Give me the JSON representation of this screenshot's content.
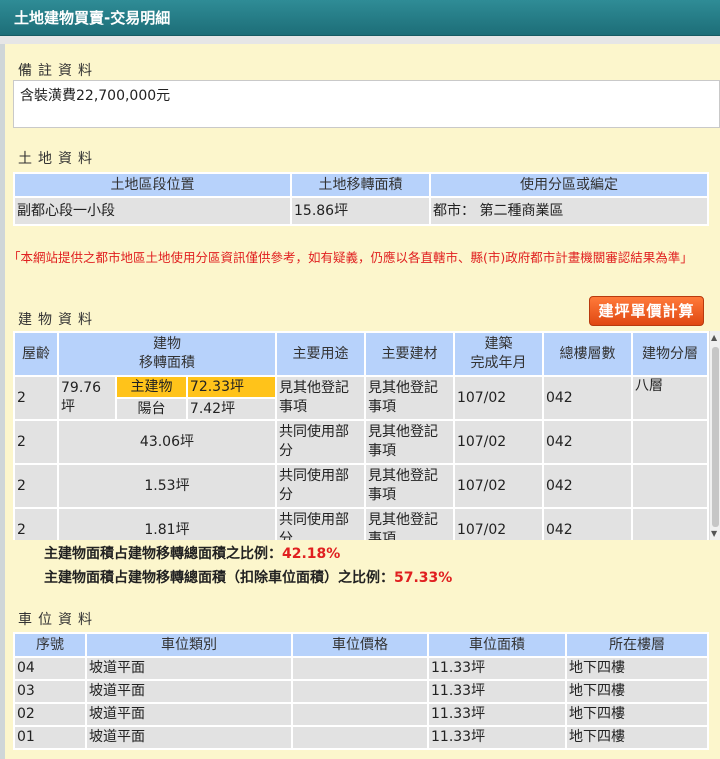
{
  "title": "土地建物買賣-交易明細",
  "note": {
    "heading": "備註資料",
    "text": "含裝潢費22,700,000元"
  },
  "land": {
    "heading": "土地資料",
    "headers": [
      "土地區段位置",
      "土地移轉面積",
      "使用分區或編定"
    ],
    "rows": [
      [
        "副都心段一小段",
        "15.86坪",
        "都市： 第二種商業區"
      ]
    ]
  },
  "warning": "「本網站提供之都市地區土地使用分區資訊僅供參考，如有疑義，仍應以各直轄市、縣(市)政府都市計畫機關審認結果為準」",
  "calc_button": "建坪單價計算",
  "building": {
    "heading": "建物資料",
    "headers": {
      "age": "屋齡",
      "area": "建物\n移轉面積",
      "use": "主要用途",
      "material": "主要建材",
      "built": "建築\n完成年月",
      "floors": "總樓層數",
      "division": "建物分層"
    },
    "first_row": {
      "age": "2",
      "total_area": "79.76坪",
      "main_label": "主建物",
      "main_area": "72.33坪",
      "balcony_label": "陽台",
      "balcony_area": "7.42坪",
      "use": "見其他登記事項",
      "material": "見其他登記事項",
      "built": "107/02",
      "floors": "042",
      "division": "八層"
    },
    "rows": [
      {
        "age": "2",
        "area": "43.06坪",
        "use": "共同使用部分",
        "material": "見其他登記事項",
        "built": "107/02",
        "floors": "042",
        "division": ""
      },
      {
        "age": "2",
        "area": "1.53坪",
        "use": "共同使用部分",
        "material": "見其他登記事項",
        "built": "107/02",
        "floors": "042",
        "division": ""
      },
      {
        "age": "2",
        "area": "1.81坪",
        "use": "共同使用部分",
        "material": "見其他登記事項",
        "built": "107/02",
        "floors": "042",
        "division": ""
      }
    ]
  },
  "ratios": [
    {
      "label": "主建物面積占建物移轉總面積之比例：",
      "value": "42.18%"
    },
    {
      "label": "主建物面積占建物移轉總面積（扣除車位面積）之比例：",
      "value": "57.33%"
    }
  ],
  "parking": {
    "heading": "車位資料",
    "headers": [
      "序號",
      "車位類別",
      "車位價格",
      "車位面積",
      "所在樓層"
    ],
    "rows": [
      [
        "04",
        "坡道平面",
        "",
        "11.33坪",
        "地下四樓"
      ],
      [
        "03",
        "坡道平面",
        "",
        "11.33坪",
        "地下四樓"
      ],
      [
        "02",
        "坡道平面",
        "",
        "11.33坪",
        "地下四樓"
      ],
      [
        "01",
        "坡道平面",
        "",
        "11.33坪",
        "地下四樓"
      ]
    ]
  }
}
